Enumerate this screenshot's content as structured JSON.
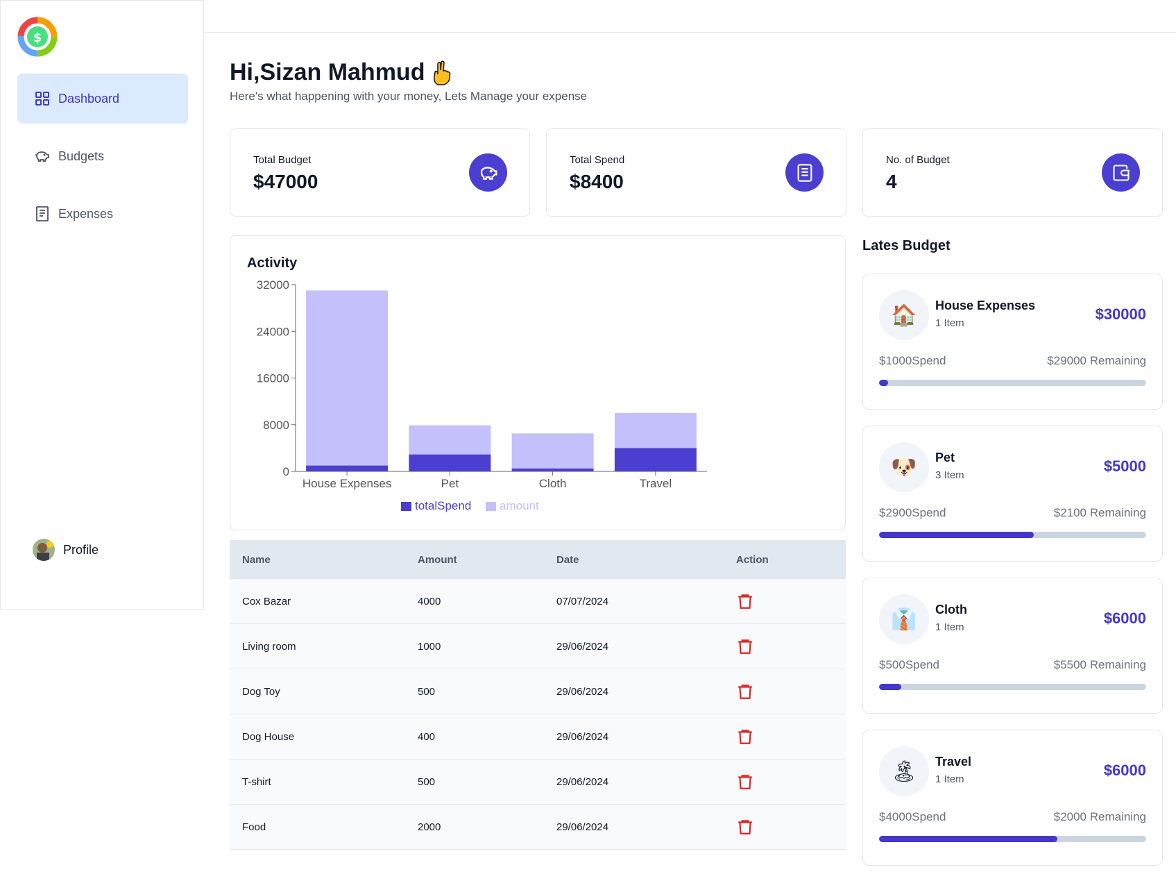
{
  "sidebar": {
    "items": [
      {
        "label": "Dashboard",
        "icon": "grid-icon",
        "active": true
      },
      {
        "label": "Budgets",
        "icon": "piggy-bank-icon",
        "active": false
      },
      {
        "label": "Expenses",
        "icon": "receipt-icon",
        "active": false
      }
    ],
    "profile_label": "Profile"
  },
  "header": {
    "greeting": "Hi,Sizan Mahmud",
    "subtitle": "Here's what happening with your money, Lets Manage your expense"
  },
  "cards": [
    {
      "label": "Total Budget",
      "value": "$47000",
      "icon": "piggy-bank-icon"
    },
    {
      "label": "Total Spend",
      "value": "$8400",
      "icon": "receipt-icon"
    },
    {
      "label": "No. of Budget",
      "value": "4",
      "icon": "wallet-icon"
    }
  ],
  "chart_data": {
    "type": "bar",
    "title": "Activity",
    "categories": [
      "House Expenses",
      "Pet",
      "Cloth",
      "Travel"
    ],
    "series": [
      {
        "name": "totalSpend",
        "values": [
          1000,
          2900,
          500,
          4000
        ],
        "color": "#4a3fd1"
      },
      {
        "name": "amount",
        "values": [
          30000,
          5000,
          6000,
          6000
        ],
        "color": "#c4c0fb"
      }
    ],
    "stacked": true,
    "ylim": [
      0,
      32000
    ],
    "yticks": [
      "0",
      "8000",
      "16000",
      "24000",
      "32000"
    ],
    "legend_position": "bottom"
  },
  "table": {
    "headers": [
      "Name",
      "Amount",
      "Date",
      "Action"
    ],
    "rows": [
      {
        "name": "Cox Bazar",
        "amount": "4000",
        "date": "07/07/2024"
      },
      {
        "name": "Living room",
        "amount": "1000",
        "date": "29/06/2024"
      },
      {
        "name": "Dog Toy",
        "amount": "500",
        "date": "29/06/2024"
      },
      {
        "name": "Dog House",
        "amount": "400",
        "date": "29/06/2024"
      },
      {
        "name": "T-shirt",
        "amount": "500",
        "date": "29/06/2024"
      },
      {
        "name": "Food",
        "amount": "2000",
        "date": "29/06/2024"
      }
    ]
  },
  "latest": {
    "title": "Lates Budget",
    "budgets": [
      {
        "icon": "🏠",
        "name": "House Expenses",
        "items": "1 Item",
        "amount": "$30000",
        "spend": "$1000Spend",
        "remaining": "$29000 Remaining",
        "progress": 0.033
      },
      {
        "icon": "🐶",
        "name": "Pet",
        "items": "3 Item",
        "amount": "$5000",
        "spend": "$2900Spend",
        "remaining": "$2100 Remaining",
        "progress": 0.58
      },
      {
        "icon": "👔",
        "name": "Cloth",
        "items": "1 Item",
        "amount": "$6000",
        "spend": "$500Spend",
        "remaining": "$5500 Remaining",
        "progress": 0.083
      },
      {
        "icon": "🏝",
        "name": "Travel",
        "items": "1 Item",
        "amount": "$6000",
        "spend": "$4000Spend",
        "remaining": "$2000 Remaining",
        "progress": 0.667
      }
    ]
  },
  "colors": {
    "accent": "#4338ca",
    "icon_bg": "#4a3fd1",
    "active_nav_bg": "#dbeafe",
    "delete": "#dc2626"
  }
}
